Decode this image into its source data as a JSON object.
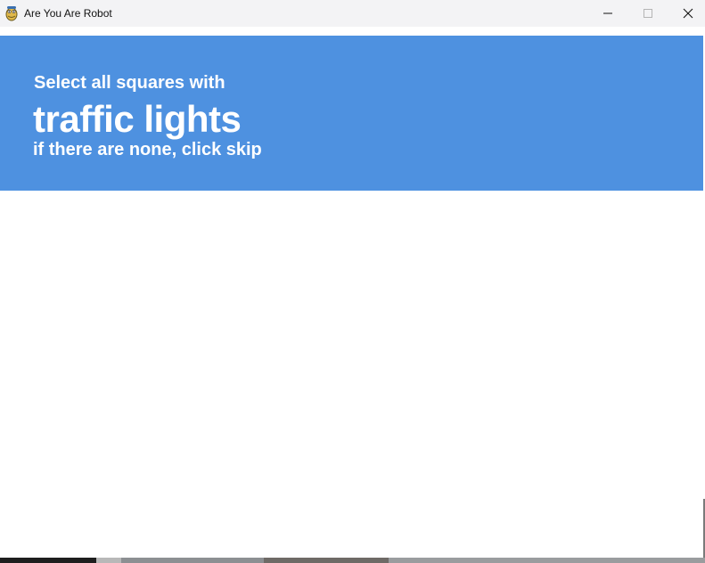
{
  "window": {
    "title": "Are You Are Robot",
    "app_icon": "python-snake-icon",
    "controls": {
      "minimize_icon": "minimize-icon",
      "maximize_icon": "maximize-icon",
      "close_icon": "close-icon"
    }
  },
  "challenge": {
    "prompt_line": "Select all squares with",
    "target": "traffic lights",
    "skip_hint": "if there are none, click skip"
  },
  "colors": {
    "banner": "#4e91e0",
    "banner_text": "#ffffff",
    "titlebar": "#f3f3f5",
    "background": "#ffffff"
  }
}
